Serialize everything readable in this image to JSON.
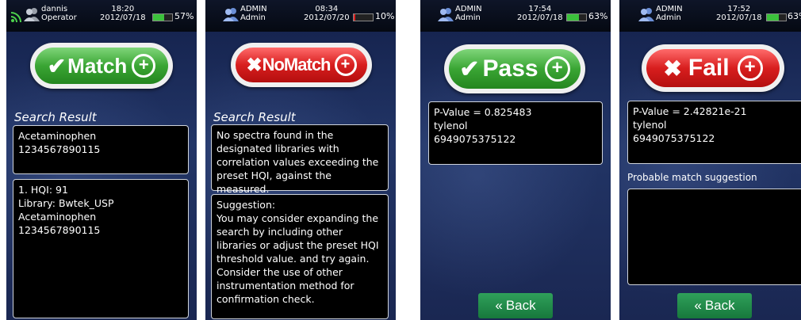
{
  "screens": [
    {
      "user_name": "dannis",
      "user_role": "Operator",
      "time": "18:20",
      "date": "2012/07/18",
      "battery_pct": "57%",
      "battery_level": 0.57,
      "battery_color": "#3cc13c",
      "result_label": "Match",
      "result_type": "match",
      "section_title": "Search Result",
      "box1": "Acetaminophen\n1234567890115",
      "box2": "1. HQI: 91\nLibrary: Bwtek_USP\nAcetaminophen\n1234567890115"
    },
    {
      "user_name": "ADMIN",
      "user_role": "Admin",
      "time": "08:34",
      "date": "2012/07/20",
      "battery_pct": "10%",
      "battery_level": 0.1,
      "battery_color": "#e02020",
      "result_label": "NoMatch",
      "result_type": "nomatch",
      "section_title": "Search Result",
      "box1": "No spectra found in the designated libraries with correlation values exceeding the preset HQI, against the measured.",
      "box2": "Suggestion:\nYou may consider expanding the search by including other libraries or adjust the preset HQI threshold value. and try again. Consider the use of other instrumentation method for confirmation check."
    },
    {
      "user_name": "ADMIN",
      "user_role": "Admin",
      "time": "17:54",
      "date": "2012/07/18",
      "battery_pct": "63%",
      "battery_level": 0.63,
      "battery_color": "#3cc13c",
      "result_label": "Pass",
      "result_type": "pass",
      "box1": "P-Value = 0.825483\ntylenol\n6949075375122",
      "back_label": "Back"
    },
    {
      "user_name": "ADMIN",
      "user_role": "Admin",
      "time": "17:52",
      "date": "2012/07/18",
      "battery_pct": "63%",
      "battery_level": 0.63,
      "battery_color": "#3cc13c",
      "result_label": "Fail",
      "result_type": "fail",
      "box1": "P-Value = 2.42821e-21\ntylenol\n6949075375122",
      "suggestion_label": "Probable match suggestion",
      "box2": "",
      "back_label": "Back"
    }
  ]
}
